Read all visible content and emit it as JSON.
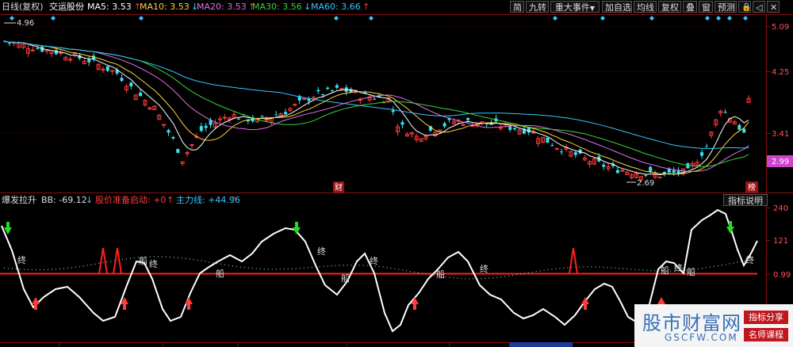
{
  "header": {
    "period": "日线(复权)",
    "stock_name": "交运股份",
    "ma": [
      {
        "label": "MA5: 3.53",
        "arrow": "↑",
        "color": "#ffffff",
        "arrow_color": "#ff3b3b"
      },
      {
        "label": "MA10: 3.53",
        "arrow": "↓",
        "color": "#ffd23b",
        "arrow_color": "#36c6ff"
      },
      {
        "label": "MA20: 3.53",
        "arrow": "↑",
        "color": "#e36fe3",
        "arrow_color": "#ff3b3b"
      },
      {
        "label": "MA30: 3.56",
        "arrow": "↓",
        "color": "#3bd23b",
        "arrow_color": "#36c6ff"
      },
      {
        "label": "MA60: 3.66",
        "arrow": "↑",
        "color": "#36c6ff",
        "arrow_color": "#ff3b3b"
      }
    ]
  },
  "toolbar": {
    "simplified": "简",
    "nine_turn": "九转",
    "major_events": "重大事件",
    "add_watchlist": "加自选",
    "ma_lines": "均线",
    "adjust": "复权",
    "overlay": "叠",
    "window": "窗",
    "alert": "预测",
    "lock_icon": "lock-icon",
    "back_icon": "back-icon",
    "close_icon": "close-icon"
  },
  "price_axis": {
    "ticks": [
      "5.09",
      "4.25",
      "3.41"
    ],
    "current": "2.99",
    "current_color": "#cc44cc"
  },
  "price_chart": {
    "high_marker": "4.96",
    "low_marker": "2.69",
    "event_fin": "财",
    "event_rank": "榜"
  },
  "indicator": {
    "name": "爆发拉升",
    "bb_label": "BB: -69.12",
    "bb_arrow": "↓",
    "start_label": "股价准备启动: +0",
    "start_arrow": "↑",
    "main_label": "主力线: +44.96",
    "main_arrow": "↑",
    "explain_button": "指标说明",
    "axis": [
      "240",
      "121",
      "0.99"
    ],
    "marks": {
      "end": "终",
      "ship": "船"
    }
  },
  "watermark": {
    "title": "股市财富网",
    "url": "GSCFW.COM",
    "badge1": "指标分享",
    "badge2": "名师课程"
  },
  "date_axis": {
    "highlight": "2021-06-02"
  },
  "colors": {
    "up": "#ff3b3b",
    "down": "#36e4f4",
    "baseline": "#ff2020",
    "grid": "#8a1010"
  }
}
